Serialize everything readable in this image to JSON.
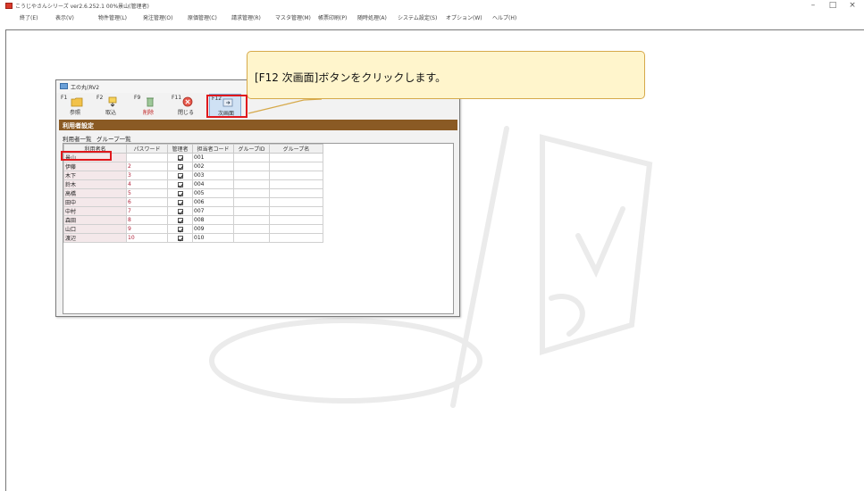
{
  "window": {
    "title": "こうじやさんシリーズ ver2.6.252.1 00%景山(管理者)",
    "minimize": "–",
    "maximize": "□",
    "close": "×"
  },
  "menu": [
    "終了(E)",
    "表示(V)",
    "物件管理(L)",
    "発注管理(O)",
    "原価管理(C)",
    "請求管理(R)",
    "マスタ管理(M)",
    "帳票印刷(P)",
    "随時処理(A)",
    "システム設定(S)",
    "オプション(W)",
    "ヘルプ(H)"
  ],
  "dialog": {
    "title": "工の丸(RV2",
    "toolbar": [
      {
        "key": "F1",
        "label": "参照",
        "icon": "folder-icon",
        "red": false
      },
      {
        "key": "F2",
        "label": "取込",
        "icon": "import-icon",
        "red": false
      },
      {
        "key": "F9",
        "label": "削除",
        "icon": "trash-icon",
        "red": true
      },
      {
        "key": "F11",
        "label": "閉じる",
        "icon": "close-circle-icon",
        "red": false
      },
      {
        "key": "F12",
        "label": "次画面",
        "icon": "next-screen-icon",
        "red": false
      }
    ],
    "section_title": "利用者設定",
    "tabs": [
      "利用者一覧",
      "グループ一覧"
    ],
    "columns": [
      "利用者名",
      "パスワード",
      "管理者",
      "担当者コード",
      "グループID",
      "グループ名"
    ],
    "rows": [
      {
        "name": "景山",
        "password": "",
        "admin": true,
        "code": "001",
        "group_id": "",
        "group_name": ""
      },
      {
        "name": "伊藤",
        "password": "2",
        "admin": true,
        "code": "002",
        "group_id": "",
        "group_name": ""
      },
      {
        "name": "木下",
        "password": "3",
        "admin": true,
        "code": "003",
        "group_id": "",
        "group_name": ""
      },
      {
        "name": "鈴木",
        "password": "4",
        "admin": true,
        "code": "004",
        "group_id": "",
        "group_name": ""
      },
      {
        "name": "高橋",
        "password": "5",
        "admin": true,
        "code": "005",
        "group_id": "",
        "group_name": ""
      },
      {
        "name": "田中",
        "password": "6",
        "admin": true,
        "code": "006",
        "group_id": "",
        "group_name": ""
      },
      {
        "name": "中村",
        "password": "7",
        "admin": true,
        "code": "007",
        "group_id": "",
        "group_name": ""
      },
      {
        "name": "森田",
        "password": "8",
        "admin": true,
        "code": "008",
        "group_id": "",
        "group_name": ""
      },
      {
        "name": "山口",
        "password": "9",
        "admin": true,
        "code": "009",
        "group_id": "",
        "group_name": ""
      },
      {
        "name": "渡辺",
        "password": "10",
        "admin": true,
        "code": "010",
        "group_id": "",
        "group_name": ""
      }
    ]
  },
  "callout": {
    "text": "[F12 次画面]ボタンをクリックします。"
  },
  "colors": {
    "section_bar": "#8a5a24",
    "highlight": "#e0181c",
    "callout_bg": "#fff5cc"
  }
}
